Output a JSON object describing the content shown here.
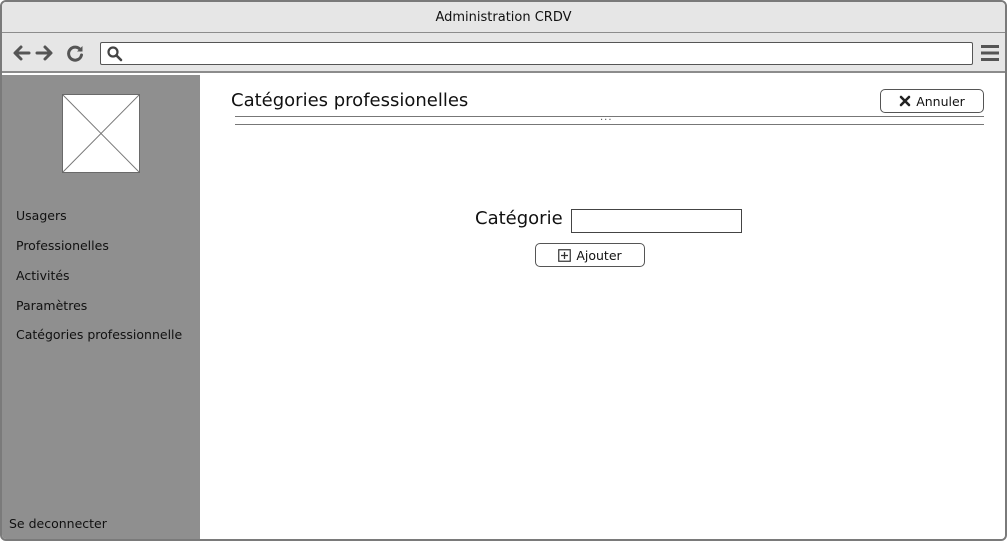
{
  "window": {
    "title": "Administration CRDV"
  },
  "browser": {
    "url_value": "",
    "icons": [
      "back-arrow-icon",
      "forward-arrow-icon",
      "reload-icon",
      "search-icon",
      "hamburger-menu-icon"
    ]
  },
  "sidebar": {
    "logo_icon": "image-placeholder-icon",
    "items": [
      {
        "label": "Usagers"
      },
      {
        "label": "Professionelles"
      },
      {
        "label": "Activités"
      },
      {
        "label": "Paramètres"
      },
      {
        "label": "Catégories professionnelle"
      }
    ],
    "logout_label": "Se deconnecter"
  },
  "main": {
    "title": "Catégories professionelles",
    "cancel_label": "Annuler",
    "cancel_icon": "close-x-icon",
    "grip": "...",
    "form": {
      "label": "Catégorie",
      "input_value": "",
      "add_label": "Ajouter",
      "add_icon": "plus-box-icon"
    }
  },
  "colors": {
    "chrome": "#e6e6e6",
    "sidebar": "#8f8f8f",
    "border": "#7a7a7a"
  }
}
